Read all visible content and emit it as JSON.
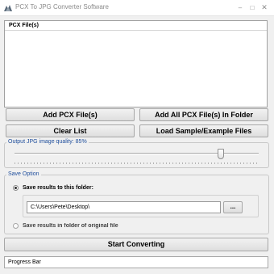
{
  "window": {
    "title": "PCX To JPG Converter Software",
    "controls": {
      "minimize": "–",
      "maximize": "□",
      "close": "✕"
    }
  },
  "file_list": {
    "header": "PCX File(s)"
  },
  "buttons": {
    "add_files": "Add PCX File(s)",
    "add_all_folder": "Add All PCX File(s) In Folder",
    "clear_list": "Clear List",
    "load_sample": "Load Sample/Example Files",
    "browse": "...",
    "start": "Start Converting"
  },
  "quality": {
    "legend": "Output JPG image quality: 85%",
    "value_percent": 85
  },
  "save_option": {
    "legend": "Save Option",
    "save_to_folder_label": "Save results to this folder:",
    "folder_path": "C:\\Users\\Pete\\Desktop\\",
    "save_original_label": "Save results in folder of original file",
    "selected": "folder"
  },
  "progress": {
    "text": "Progress Bar"
  }
}
